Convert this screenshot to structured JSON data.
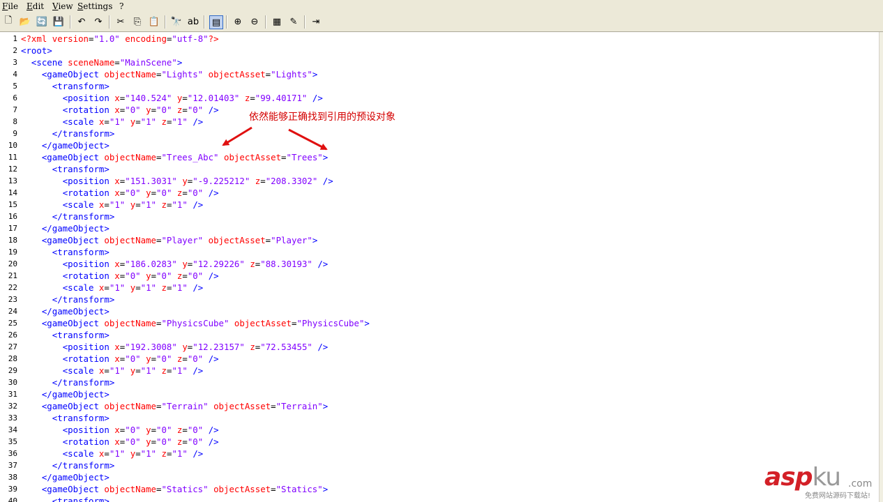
{
  "menubar": {
    "items": [
      "File",
      "Edit",
      "View",
      "Settings",
      "?"
    ]
  },
  "toolbar": {
    "buttons": [
      {
        "name": "new-file-icon",
        "glyph": "🗋"
      },
      {
        "name": "open-file-icon",
        "glyph": "📂"
      },
      {
        "name": "reload-icon",
        "glyph": "🔄"
      },
      {
        "name": "save-icon",
        "glyph": "💾"
      },
      {
        "name": "undo-icon",
        "glyph": "↶"
      },
      {
        "name": "redo-icon",
        "glyph": "↷"
      },
      {
        "name": "cut-icon",
        "glyph": "✂"
      },
      {
        "name": "copy-icon",
        "glyph": "⎘"
      },
      {
        "name": "paste-icon",
        "glyph": "📋"
      },
      {
        "name": "find-icon",
        "glyph": "🔭"
      },
      {
        "name": "replace-icon",
        "glyph": "ab"
      },
      {
        "name": "word-wrap-icon",
        "glyph": "▤"
      },
      {
        "name": "zoom-in-icon",
        "glyph": "⊕"
      },
      {
        "name": "zoom-out-icon",
        "glyph": "⊖"
      },
      {
        "name": "scheme-icon",
        "glyph": "▦"
      },
      {
        "name": "customize-icon",
        "glyph": "✎"
      },
      {
        "name": "exit-icon",
        "glyph": "⇥"
      }
    ]
  },
  "annotation": "依然能够正确找到引用的预设对象",
  "watermark": {
    "brand_main": "asp",
    "brand_k": "ku",
    "domain": ".com",
    "tagline": "免费网站源码下载站!"
  },
  "colors": {
    "tag": "#0000ff",
    "attr": "#ff0000",
    "value": "#8000ff",
    "annotation": "#d40000"
  },
  "code_lines": [
    "<?xml version=\"1.0\" encoding=\"utf-8\"?>",
    "<root>",
    "  <scene sceneName=\"MainScene\">",
    "    <gameObject objectName=\"Lights\" objectAsset=\"Lights\">",
    "      <transform>",
    "        <position x=\"140.524\" y=\"12.01403\" z=\"99.40171\" />",
    "        <rotation x=\"0\" y=\"0\" z=\"0\" />",
    "        <scale x=\"1\" y=\"1\" z=\"1\" />",
    "      </transform>",
    "    </gameObject>",
    "    <gameObject objectName=\"Trees_Abc\" objectAsset=\"Trees\">",
    "      <transform>",
    "        <position x=\"151.3031\" y=\"-9.225212\" z=\"208.3302\" />",
    "        <rotation x=\"0\" y=\"0\" z=\"0\" />",
    "        <scale x=\"1\" y=\"1\" z=\"1\" />",
    "      </transform>",
    "    </gameObject>",
    "    <gameObject objectName=\"Player\" objectAsset=\"Player\">",
    "      <transform>",
    "        <position x=\"186.0283\" y=\"12.29226\" z=\"88.30193\" />",
    "        <rotation x=\"0\" y=\"0\" z=\"0\" />",
    "        <scale x=\"1\" y=\"1\" z=\"1\" />",
    "      </transform>",
    "    </gameObject>",
    "    <gameObject objectName=\"PhysicsCube\" objectAsset=\"PhysicsCube\">",
    "      <transform>",
    "        <position x=\"192.3008\" y=\"12.23157\" z=\"72.53455\" />",
    "        <rotation x=\"0\" y=\"0\" z=\"0\" />",
    "        <scale x=\"1\" y=\"1\" z=\"1\" />",
    "      </transform>",
    "    </gameObject>",
    "    <gameObject objectName=\"Terrain\" objectAsset=\"Terrain\">",
    "      <transform>",
    "        <position x=\"0\" y=\"0\" z=\"0\" />",
    "        <rotation x=\"0\" y=\"0\" z=\"0\" />",
    "        <scale x=\"1\" y=\"1\" z=\"1\" />",
    "      </transform>",
    "    </gameObject>",
    "    <gameObject objectName=\"Statics\" objectAsset=\"Statics\">",
    "      <transform>"
  ]
}
